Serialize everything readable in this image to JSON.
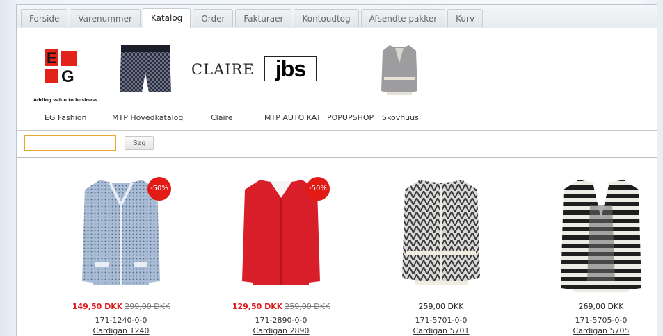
{
  "tabs": [
    "Forside",
    "Varenummer",
    "Katalog",
    "Order",
    "Fakturaer",
    "Kontoudtog",
    "Afsendte pakker",
    "Kurv"
  ],
  "active_tab": "Katalog",
  "brands": {
    "eg_tagline": "Adding value to business",
    "eg_letters": [
      "E",
      "G"
    ],
    "claire_logo": "CLAIRE",
    "jbs_logo": "jbs",
    "links": [
      "EG Fashion",
      "MTP Hovedkatalog",
      "Claire",
      "MTP AUTO KAT",
      "POPUPSHOP",
      "Skovhuus"
    ]
  },
  "search": {
    "value": "",
    "button": "Søg"
  },
  "products": [
    {
      "badge": "-50%",
      "price": "149,50 DKK",
      "old_price": "299,00 DKK",
      "sku": "171-1240-0-0",
      "name": "Cardigan 1240",
      "color": "#a9bdd6"
    },
    {
      "badge": "-50%",
      "price": "129,50 DKK",
      "old_price": "259,00 DKK",
      "sku": "171-2890-0-0",
      "name": "Cardigan 2890",
      "color": "#d81e28"
    },
    {
      "badge": "",
      "price": "259,00 DKK",
      "old_price": "",
      "sku": "171-5701-0-0",
      "name": "Cardigan 5701",
      "color": "#8a8a8a"
    },
    {
      "badge": "",
      "price": "269,00 DKK",
      "old_price": "",
      "sku": "171-5705-0-0",
      "name": "Cardigan 5705",
      "color": "#222222"
    }
  ]
}
